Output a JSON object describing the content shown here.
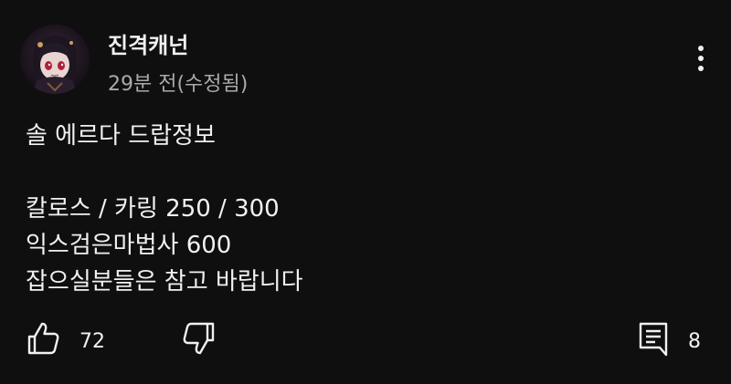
{
  "comment": {
    "author": "진격캐넌",
    "timestamp": "29분 전(수정됨)",
    "body_lines": [
      "솔 에르다 드랍정보",
      "칼로스 / 카링 250 / 300",
      "익스검은마법사 600",
      "잡으실분들은 참고 바랍니다"
    ]
  },
  "actions": {
    "like_count": "72",
    "reply_count": "8"
  },
  "icons": {
    "like": "thumbs-up-icon",
    "dislike": "thumbs-down-icon",
    "reply": "comment-icon",
    "more": "more-vertical-icon"
  },
  "colors": {
    "background": "#0f0f0f",
    "text_primary": "#f1f1f1",
    "text_secondary": "#aaaaaa"
  }
}
